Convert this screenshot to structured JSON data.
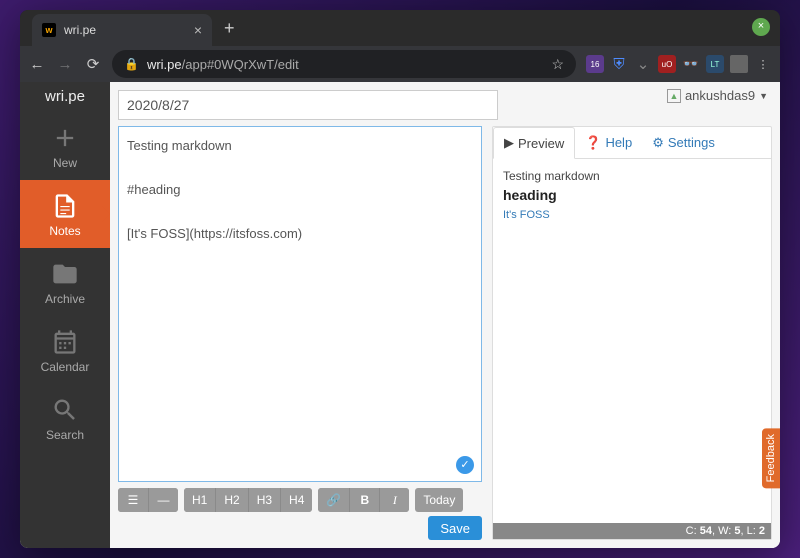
{
  "browser": {
    "tab_title": "wri.pe",
    "tab_favicon_text": "w",
    "url_host": "wri.pe",
    "url_path": "/app#0WQrXwT/edit",
    "extensions": {
      "badge_count": "16",
      "ublock": "uO",
      "lt": "LT"
    }
  },
  "app": {
    "brand": "wri.pe",
    "user": {
      "name": "ankushdas9"
    },
    "sidebar": [
      {
        "label": "New"
      },
      {
        "label": "Notes"
      },
      {
        "label": "Archive"
      },
      {
        "label": "Calendar"
      },
      {
        "label": "Search"
      }
    ],
    "title_value": "2020/8/27",
    "editor_text": "Testing markdown\n\n#heading\n\n[It's FOSS](https://itsfoss.com)",
    "toolbar": {
      "h1": "H1",
      "h2": "H2",
      "h3": "H3",
      "h4": "H4",
      "bold": "B",
      "italic": "I",
      "today": "Today"
    },
    "save_label": "Save",
    "preview_tabs": {
      "preview": "Preview",
      "help": "Help",
      "settings": "Settings"
    },
    "preview": {
      "line1": "Testing markdown",
      "heading": "heading",
      "link_text": "It's FOSS"
    },
    "stats": {
      "c": "54",
      "w": "5",
      "l": "2"
    },
    "feedback_label": "Feedback"
  }
}
